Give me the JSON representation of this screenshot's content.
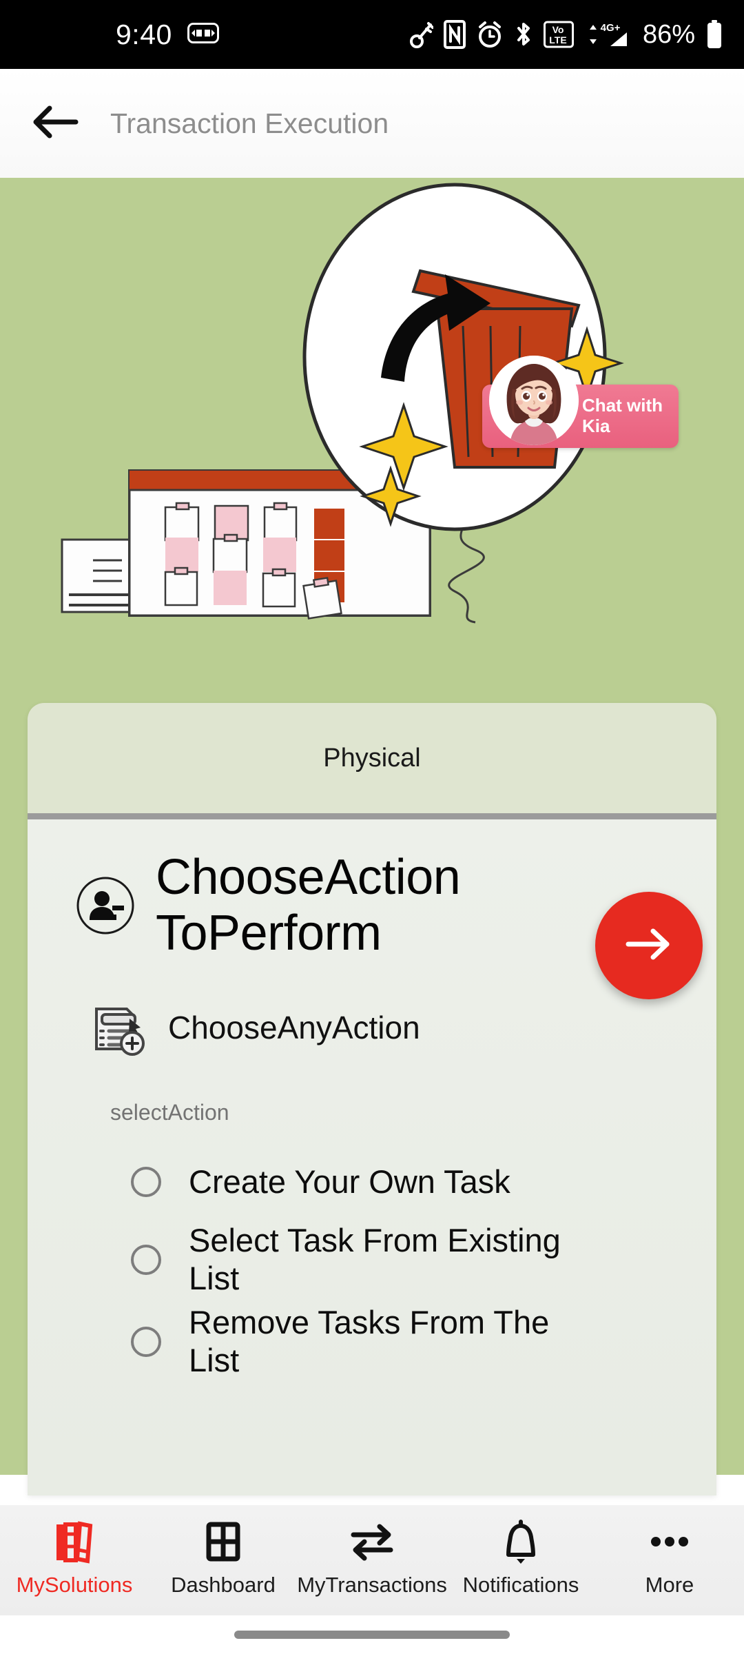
{
  "status_bar": {
    "time": "9:40",
    "battery_percent": "86%",
    "icons": [
      "id-card-icon",
      "key-icon",
      "nfc-icon",
      "alarm-icon",
      "bluetooth-icon",
      "volte-icon",
      "signal-4g-plus-icon",
      "battery-icon"
    ]
  },
  "app_bar": {
    "back_icon": "arrow-left-icon",
    "title": "Transaction Execution"
  },
  "hero": {
    "background_color": "#bace92",
    "illustration_name": "kanban-board-with-trash-bin-illustration",
    "chat_badge": {
      "line1": "Chat with",
      "line2": "Kia",
      "background_color": "#e9607e",
      "avatar_name": "kia-assistant-avatar"
    }
  },
  "card": {
    "header_title": "Physical",
    "header_color": "#dfe5d0",
    "body_color": "#e9ede5",
    "title": "ChooseAction ToPerform",
    "title_icon": "person-remove-icon",
    "subtitle": "ChooseAnyAction",
    "subtitle_icon": "checklist-add-icon",
    "field_label": "selectAction",
    "options": [
      {
        "label": "Create Your Own Task",
        "selected": false
      },
      {
        "label": "Select Task From Existing List",
        "selected": false
      },
      {
        "label": "Remove Tasks From The List",
        "selected": false
      }
    ]
  },
  "fab": {
    "icon": "arrow-right-icon",
    "color": "#e62a20",
    "label": "next"
  },
  "bottom_nav": {
    "active_color": "#ef2a23",
    "items": [
      {
        "label": "MySolutions",
        "icon": "books-icon",
        "active": true
      },
      {
        "label": "Dashboard",
        "icon": "grid-icon",
        "active": false
      },
      {
        "label": "MyTransactions",
        "icon": "swap-arrows-icon",
        "active": false
      },
      {
        "label": "Notifications",
        "icon": "bell-icon",
        "active": false
      },
      {
        "label": "More",
        "icon": "ellipsis-icon",
        "active": false
      }
    ]
  }
}
